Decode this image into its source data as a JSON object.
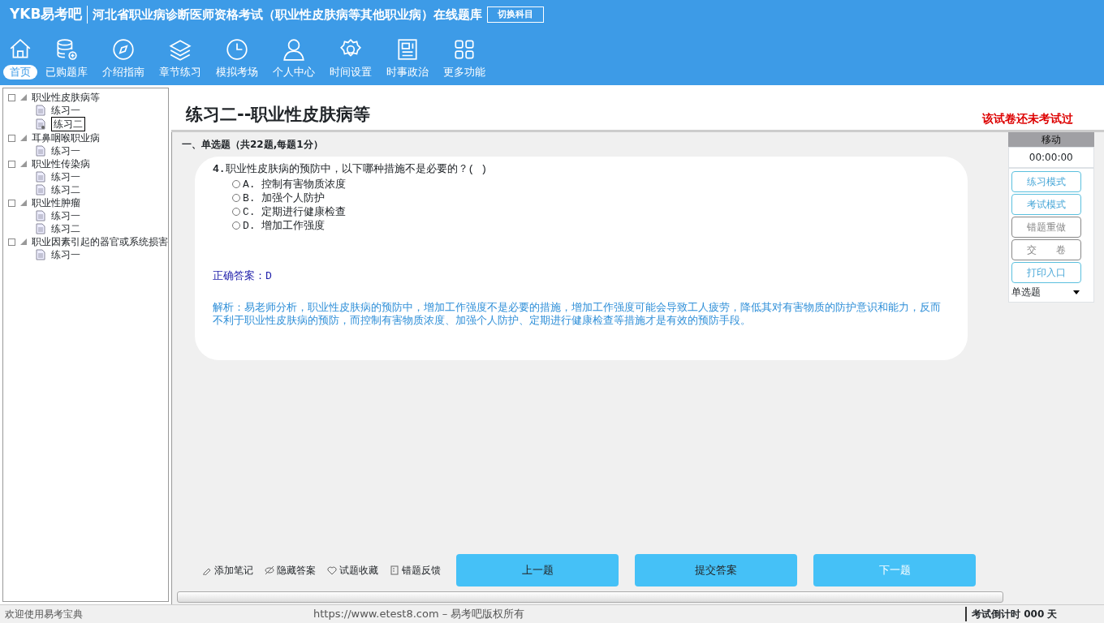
{
  "header": {
    "logo": "YKB易考吧",
    "title": "河北省职业病诊断医师资格考试（职业性皮肤病等其他职业病）在线题库",
    "switch_button": "切换科目"
  },
  "nav": [
    {
      "label": "首页",
      "selected": true
    },
    {
      "label": "已购题库",
      "selected": false
    },
    {
      "label": "介绍指南",
      "selected": false
    },
    {
      "label": "章节练习",
      "selected": false
    },
    {
      "label": "模拟考场",
      "selected": false
    },
    {
      "label": "个人中心",
      "selected": false
    },
    {
      "label": "时间设置",
      "selected": false
    },
    {
      "label": "时事政治",
      "selected": false
    },
    {
      "label": "更多功能",
      "selected": false
    }
  ],
  "tree": [
    {
      "label": "职业性皮肤病等",
      "expanded": true,
      "children": [
        {
          "label": "练习一",
          "selected": false
        },
        {
          "label": "练习二",
          "selected": true
        }
      ]
    },
    {
      "label": "耳鼻咽喉职业病",
      "expanded": true,
      "children": [
        {
          "label": "练习一",
          "selected": false
        }
      ]
    },
    {
      "label": "职业性传染病",
      "expanded": true,
      "children": [
        {
          "label": "练习一",
          "selected": false
        },
        {
          "label": "练习二",
          "selected": false
        }
      ]
    },
    {
      "label": "职业性肿瘤",
      "expanded": true,
      "children": [
        {
          "label": "练习一",
          "selected": false
        },
        {
          "label": "练习二",
          "selected": false
        }
      ]
    },
    {
      "label": "职业因素引起的器官或系统损害",
      "expanded": true,
      "children": [
        {
          "label": "练习一",
          "selected": false
        }
      ]
    }
  ],
  "paper": {
    "title": "练习二--职业性皮肤病等",
    "status": "该试卷还未考试过"
  },
  "section": "一、单选题（共22题,每题1分）",
  "question": {
    "number": "4.",
    "text": "职业性皮肤病的预防中，以下哪种措施不是必要的？( )",
    "options": [
      {
        "label": "A. 控制有害物质浓度",
        "checked": false
      },
      {
        "label": "B. 加强个人防护",
        "checked": false
      },
      {
        "label": "C. 定期进行健康检查",
        "checked": false
      },
      {
        "label": "D. 增加工作强度",
        "checked": false
      }
    ],
    "answer": "正确答案：D",
    "analysis": "解析：易老师分析，职业性皮肤病的预防中，增加工作强度不是必要的措施，增加工作强度可能会导致工人疲劳，降低其对有害物质的防护意识和能力，反而不利于职业性皮肤病的预防，而控制有害物质浓度、加强个人防护、定期进行健康检查等措施才是有效的预防手段。"
  },
  "panel": {
    "move": "移动",
    "timer": "00:00:00",
    "buttons": [
      {
        "label": "练习模式",
        "kind": "blue"
      },
      {
        "label": "考试模式",
        "kind": "blue"
      },
      {
        "label": "错题重做",
        "kind": "grey"
      },
      {
        "label": "交　　卷",
        "kind": "grey"
      },
      {
        "label": "打印入口",
        "kind": "blue"
      }
    ],
    "type_select": "单选题"
  },
  "tools": [
    "添加笔记",
    "隐藏答案",
    "试题收藏",
    "错题反馈"
  ],
  "nav_buttons": [
    {
      "label": "上一题",
      "kind": "dark"
    },
    {
      "label": "提交答案",
      "kind": "dark"
    },
    {
      "label": "下一题",
      "kind": "light"
    }
  ],
  "status_bar": {
    "welcome": "欢迎使用易考宝典",
    "copyright": "https://www.etest8.com – 易考吧版权所有",
    "countdown": "考试倒计时 000 天"
  }
}
